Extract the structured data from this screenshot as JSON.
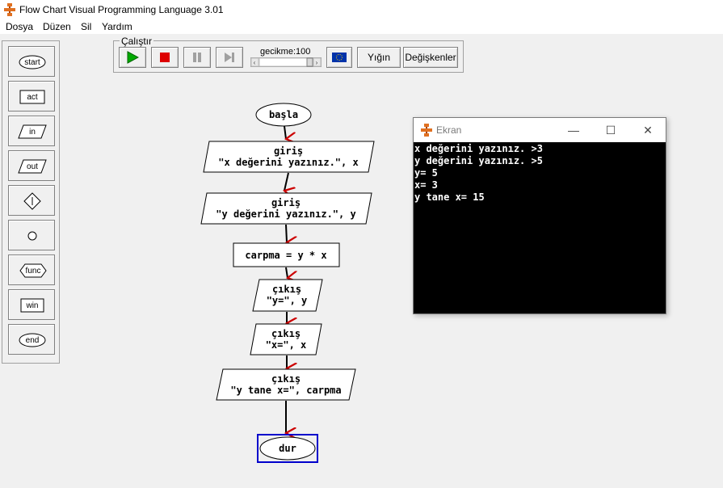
{
  "window": {
    "title": "Flow Chart Visual Programming Language 3.01"
  },
  "menu": {
    "items": [
      "Dosya",
      "Düzen",
      "Sil",
      "Yardım"
    ]
  },
  "palette": {
    "items": [
      "start",
      "act",
      "in",
      "out",
      "",
      "",
      "func",
      "win",
      "end"
    ]
  },
  "toolbar": {
    "group_label": "Çalıştır",
    "delay_label": "gecikme:100",
    "stack_label": "Yığın",
    "variables_label": "Değişkenler"
  },
  "flowchart": {
    "start": "başla",
    "input1": {
      "title": "giriş",
      "expr": "\"x değerini yazınız.\", x"
    },
    "input2": {
      "title": "giriş",
      "expr": "\"y değerini yazınız.\", y"
    },
    "action": "carpma = y * x",
    "output1": {
      "title": "çıkış",
      "expr": "\"y=\", y"
    },
    "output2": {
      "title": "çıkış",
      "expr": "\"x=\", x"
    },
    "output3": {
      "title": "çıkış",
      "expr": "\"y tane x=\", carpma"
    },
    "end": "dur"
  },
  "screen_window": {
    "title": "Ekran",
    "lines": [
      "x değerini yazınız. >3",
      "y değerini yazınız. >5",
      "y= 5",
      "x= 3",
      "y tane x= 15"
    ]
  },
  "colors": {
    "arrow": "#cc0000",
    "selection": "#0000cc",
    "play": "#00aa00",
    "stop": "#dd0000"
  }
}
